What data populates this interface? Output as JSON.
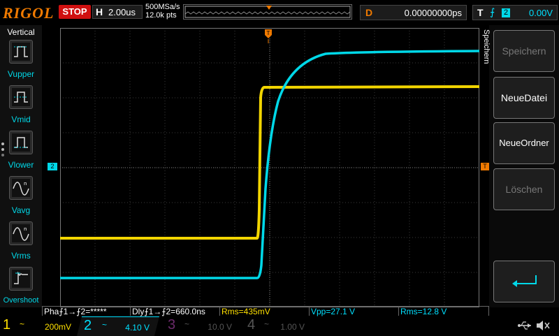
{
  "brand": "RIGOL",
  "run_state": "STOP",
  "horizontal": {
    "label": "H",
    "timebase": "2.00us",
    "sample_rate": "500MSa/s",
    "points": "12.0k pts"
  },
  "delay": {
    "label": "D",
    "value": "0.00000000ps"
  },
  "trigger": {
    "label": "T",
    "slope": "⨍",
    "source": "2",
    "level": "0.00V"
  },
  "left_menu": {
    "title": "Vertical",
    "items": [
      {
        "label": "Vupper",
        "icon": "vupper-icon"
      },
      {
        "label": "Vmid",
        "icon": "vmid-icon"
      },
      {
        "label": "Vlower",
        "icon": "vlower-icon"
      },
      {
        "label": "Vavg",
        "icon": "vavg-icon"
      },
      {
        "label": "Vrms",
        "icon": "vrms-icon"
      },
      {
        "label": "Overshoot",
        "icon": "overshoot-icon"
      }
    ]
  },
  "right_menu": {
    "title": "Speichern",
    "items": [
      {
        "label": "Speichern",
        "enabled": false
      },
      {
        "label": "NeueDatei",
        "enabled": true
      },
      {
        "label": "NeueOrdner",
        "enabled": true
      },
      {
        "label": "Löschen",
        "enabled": false
      }
    ],
    "back_icon": "return-arrow-icon"
  },
  "markers": {
    "ch2_ground": "2",
    "trigger_level": "T",
    "trigger_pos": "T"
  },
  "measurements": [
    {
      "text": "Pha⨍1→⨍2=*****",
      "color": "#ffffff"
    },
    {
      "text": "Dly⨍1→⨍2=660.0ns",
      "color": "#ffffff"
    },
    {
      "text": "Rms=435mV",
      "color": "#ffe000"
    },
    {
      "text": "Vpp=27.1 V",
      "color": "#00e0ff"
    },
    {
      "text": "Rms=12.8 V",
      "color": "#00e0ff"
    }
  ],
  "channels": [
    {
      "num": "1",
      "coupling": "~",
      "scale": "200mV",
      "color": "#ffe000",
      "active": true
    },
    {
      "num": "2",
      "coupling": "~",
      "scale": "4.10 V",
      "color": "#00e0ff",
      "active": true
    },
    {
      "num": "3",
      "coupling": "~",
      "scale": "10.0 V",
      "color": "#d020d0",
      "active": false
    },
    {
      "num": "4",
      "coupling": "~",
      "scale": "1.00 V",
      "color": "#3060ff",
      "active": false
    }
  ],
  "status_icons": [
    "usb-icon",
    "speaker-muted-icon"
  ],
  "colors": {
    "ch1": "#ffe000",
    "ch2": "#00e0ff",
    "accent": "#f07a00"
  }
}
